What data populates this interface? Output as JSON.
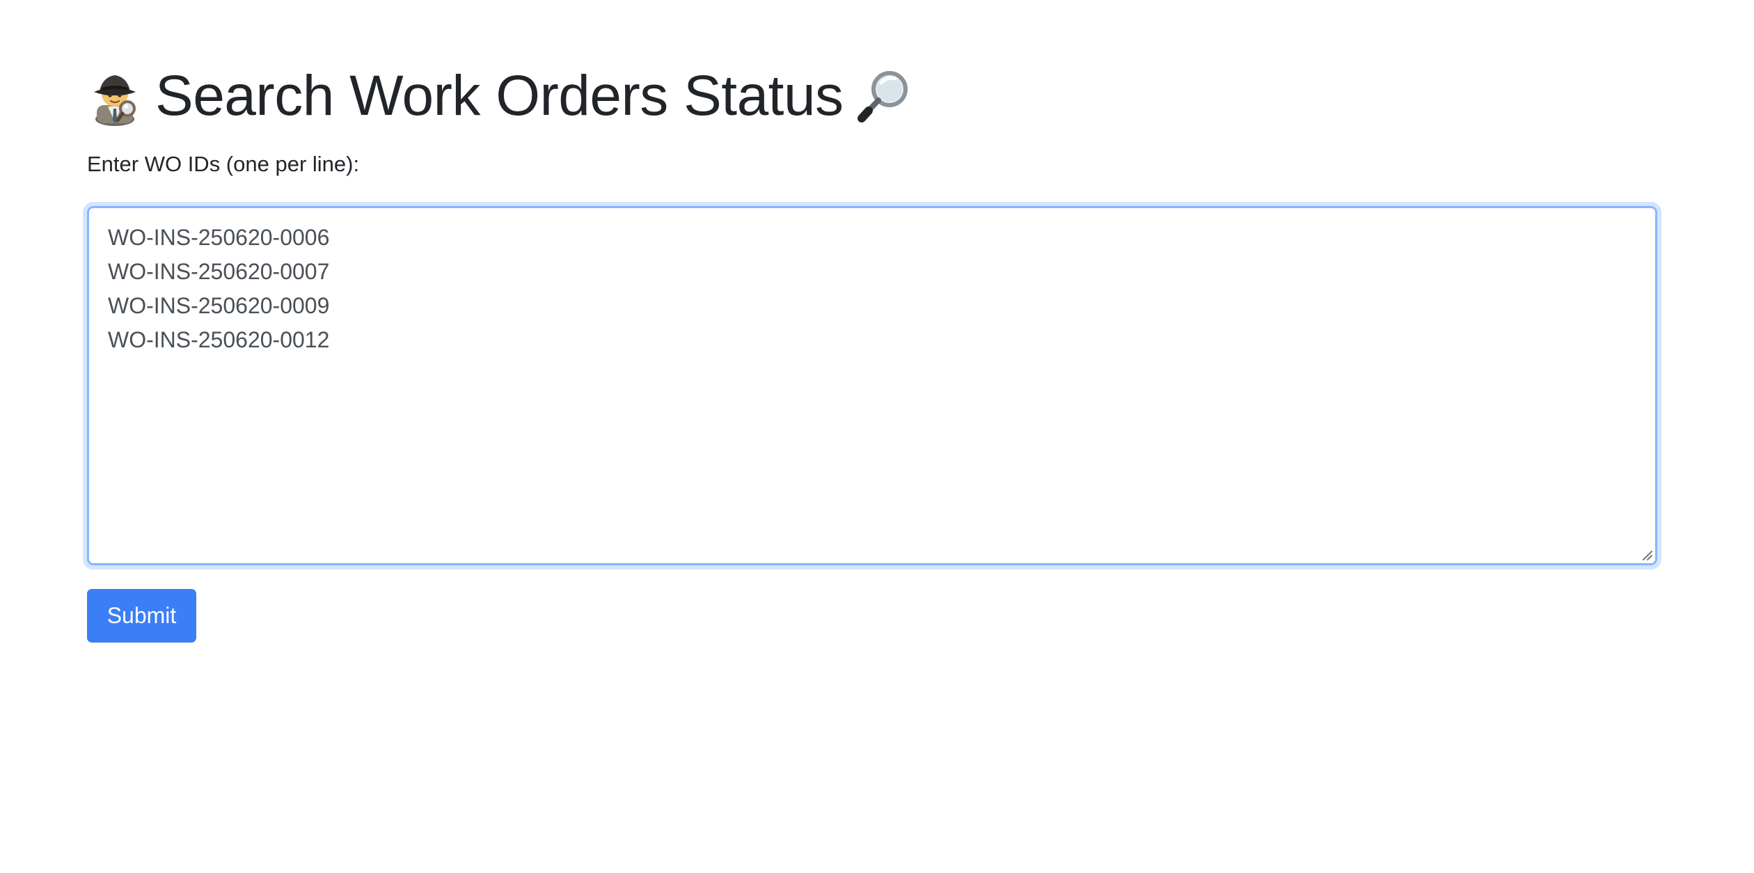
{
  "header": {
    "title": "Search Work Orders Status",
    "leading_icon": "detective-emoji-icon",
    "trailing_icon": "magnifying-glass-icon"
  },
  "form": {
    "label": "Enter WO IDs (one per line):",
    "wo_ids": [
      "WO-INS-250620-0006",
      "WO-INS-250620-0007",
      "WO-INS-250620-0009",
      "WO-INS-250620-0012"
    ],
    "submit_label": "Submit"
  },
  "colors": {
    "accent": "#3b7ff7",
    "focus_border": "#86b7fe",
    "text": "#212529"
  }
}
